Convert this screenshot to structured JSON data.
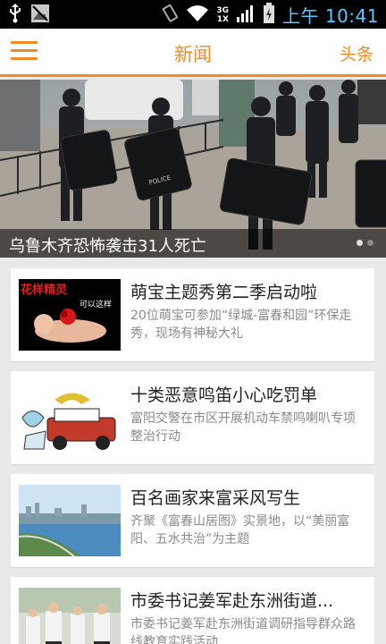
{
  "status_bar": {
    "network_top": "3G",
    "network_bottom": "1X",
    "time": "上午 10:41",
    "icons": [
      "usb-icon",
      "image-icon",
      "vibrate-icon",
      "wifi-icon",
      "signal-icon",
      "battery-icon"
    ]
  },
  "header": {
    "title": "新闻",
    "right_label": "头条",
    "accent_color": "#f08a24"
  },
  "hero": {
    "caption": "乌鲁木齐恐怖袭击31人死亡",
    "shield_text": "POLICE",
    "pages": 2,
    "active_page": 1
  },
  "news": [
    {
      "title": "萌宝主题秀第二季启动啦",
      "desc": "20位萌宝可参加“绿城-富春和园”环保走秀，现场有神秘大礼",
      "thumb_text": "花样精灵",
      "thumb_subtext": "可以这样"
    },
    {
      "title": "十类恶意鸣笛小心吃罚单",
      "desc": "富阳交警在市区开展机动车禁鸣喇叭专项整治行动"
    },
    {
      "title": "百名画家来富采风写生",
      "desc": "齐聚《富春山居图》实景地，以“美丽富阳、五水共治”为主题"
    },
    {
      "title": "市委书记姜军赴东洲街道...",
      "desc": "市委书记姜军赴东洲街道调研指导群众路线教育实践活动"
    }
  ]
}
